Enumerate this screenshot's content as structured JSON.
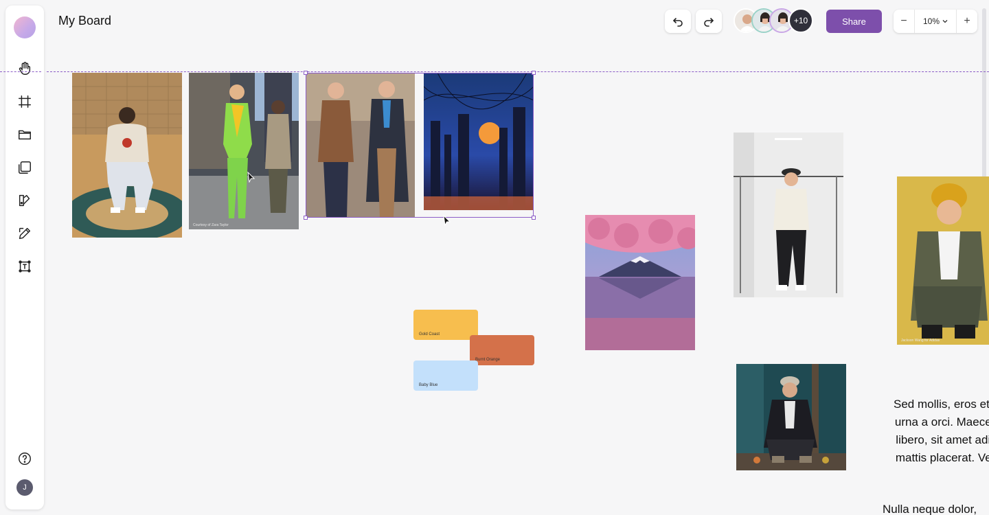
{
  "app": {
    "board_title": "My Board"
  },
  "toolbar": {
    "tools": [
      {
        "name": "hand-tool",
        "icon": "hand-icon"
      },
      {
        "name": "frame-tool",
        "icon": "frame-icon"
      },
      {
        "name": "folder-tool",
        "icon": "folder-icon"
      },
      {
        "name": "boards-tool",
        "icon": "boards-icon"
      },
      {
        "name": "color-tool",
        "icon": "palette-icon"
      },
      {
        "name": "draw-tool",
        "icon": "pencil-icon"
      },
      {
        "name": "text-tool",
        "icon": "text-icon"
      }
    ],
    "help_icon": "help-icon",
    "user_initial": "J"
  },
  "header": {
    "undo_icon": "undo-icon",
    "redo_icon": "redo-icon",
    "collaborators_more": "+10",
    "share_label": "Share",
    "zoom_minus": "−",
    "zoom_value": "10%",
    "zoom_plus": "+"
  },
  "board": {
    "images": [
      {
        "name": "photo-hoodie-man-basketball-court",
        "caption": ""
      },
      {
        "name": "photo-green-outfit-street",
        "caption": "Courtesy of Zara Taylor"
      },
      {
        "name": "photo-two-men-coats",
        "caption": ""
      },
      {
        "name": "photo-cyberpunk-city",
        "caption": ""
      },
      {
        "name": "photo-mount-fuji-cherry-blossom",
        "caption": ""
      },
      {
        "name": "photo-man-bucket-hat-studio",
        "caption": ""
      },
      {
        "name": "photo-man-yellow-beanie",
        "caption": "Jackson Wang for Adidas"
      },
      {
        "name": "photo-man-crouching-cap",
        "caption": ""
      }
    ],
    "swatches": [
      {
        "name": "Gold Coast",
        "color": "#f7be4e"
      },
      {
        "name": "Burnt Orange",
        "color": "#d4714a"
      },
      {
        "name": "Baby Blue",
        "color": "#c3e0fb"
      }
    ],
    "text_lines": [
      "Sed mollis, eros et u",
      "urna a orci. Maecen",
      "libero, sit amet adip",
      "mattis placerat. Ves"
    ],
    "text_second": "Nulla neque dolor,"
  },
  "colors": {
    "accent": "#7d4fab",
    "selection": "#8b5cc6"
  }
}
